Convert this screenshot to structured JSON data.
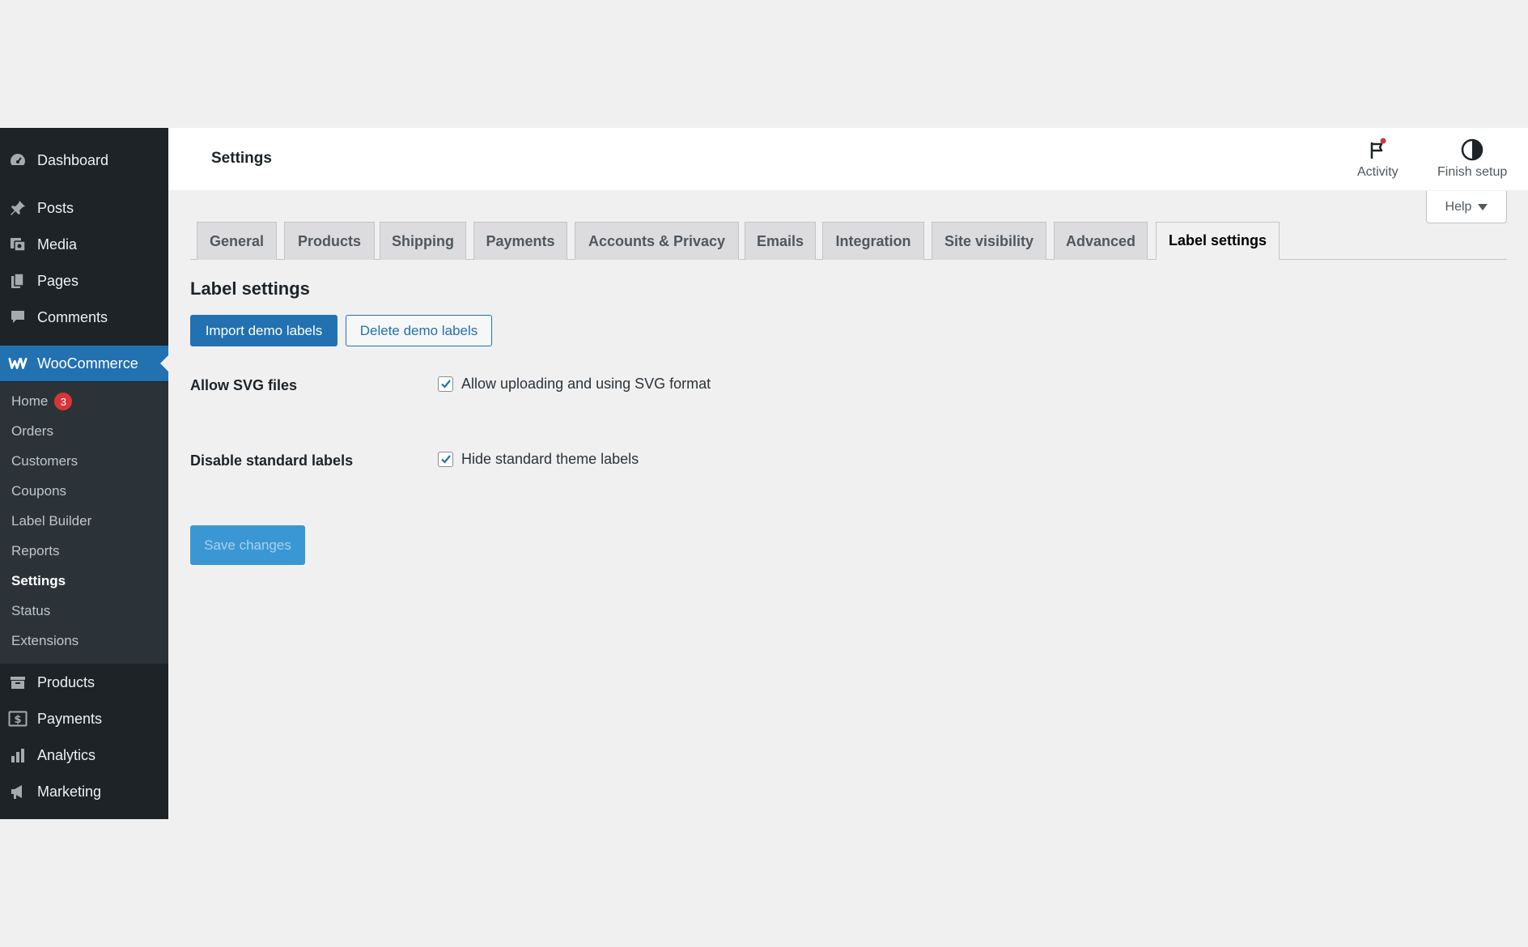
{
  "sidebar": {
    "top_items": [
      {
        "label": "Dashboard",
        "icon": "dashboard-icon"
      },
      {
        "label": "Posts",
        "icon": "pin-icon"
      },
      {
        "label": "Media",
        "icon": "media-icon"
      },
      {
        "label": "Pages",
        "icon": "pages-icon"
      },
      {
        "label": "Comments",
        "icon": "comment-icon"
      }
    ],
    "woocommerce": {
      "label": "WooCommerce",
      "icon": "woocommerce-icon"
    },
    "submenu": [
      {
        "label": "Home",
        "badge": "3"
      },
      {
        "label": "Orders"
      },
      {
        "label": "Customers"
      },
      {
        "label": "Coupons"
      },
      {
        "label": "Label Builder"
      },
      {
        "label": "Reports"
      },
      {
        "label": "Settings"
      },
      {
        "label": "Status"
      },
      {
        "label": "Extensions"
      }
    ],
    "bottom_items": [
      {
        "label": "Products",
        "icon": "archive-icon"
      },
      {
        "label": "Payments",
        "icon": "dollar-icon"
      },
      {
        "label": "Analytics",
        "icon": "bar-chart-icon"
      },
      {
        "label": "Marketing",
        "icon": "megaphone-icon"
      }
    ]
  },
  "header": {
    "title": "Settings",
    "activity_label": "Activity",
    "finish_setup_label": "Finish setup",
    "help_label": "Help"
  },
  "tabs": [
    {
      "label": "General"
    },
    {
      "label": "Products"
    },
    {
      "label": "Shipping"
    },
    {
      "label": "Payments"
    },
    {
      "label": "Accounts & Privacy"
    },
    {
      "label": "Emails"
    },
    {
      "label": "Integration"
    },
    {
      "label": "Site visibility"
    },
    {
      "label": "Advanced"
    },
    {
      "label": "Label settings",
      "active": true
    }
  ],
  "content": {
    "section_title": "Label settings",
    "import_button": "Import demo labels",
    "delete_button": "Delete demo labels",
    "fields": [
      {
        "label": "Allow SVG files",
        "option": "Allow uploading and using SVG format",
        "checked": true
      },
      {
        "label": "Disable standard labels",
        "option": "Hide standard theme labels",
        "checked": true
      }
    ],
    "save_button": "Save changes"
  },
  "colors": {
    "sidebar_bg": "#1d2327",
    "submenu_bg": "#2c3338",
    "accent": "#2271b1",
    "badge": "#d63638",
    "save_button": "#3a97d4"
  }
}
